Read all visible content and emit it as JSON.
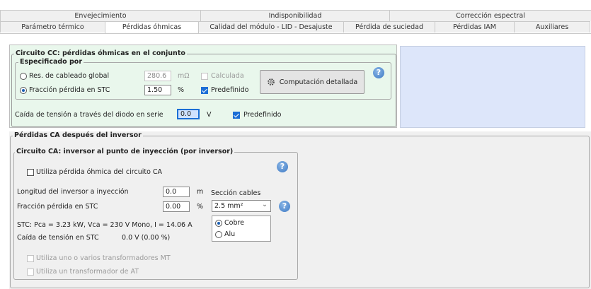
{
  "tabs_top": [
    "Envejecimiento",
    "Indisponibilidad",
    "Corrección espectral"
  ],
  "tabs_bottom": [
    {
      "label": "Parámetro térmico",
      "active": false
    },
    {
      "label": "Pérdidas óhmicas",
      "active": true
    },
    {
      "label": "Calidad del módulo - LID - Desajuste",
      "active": false
    },
    {
      "label": "Pérdida de suciedad",
      "active": false
    },
    {
      "label": "Pérdidas IAM",
      "active": false
    },
    {
      "label": "Auxiliares",
      "active": false
    }
  ],
  "dc": {
    "title": "Circuito CC: pérdidas óhmicas en el conjunto",
    "specified_title": "Especificado por",
    "res_global_label": "Res. de cableado global",
    "res_global_value": "280.6",
    "res_global_unit": "mΩ",
    "calculated_label": "Calculada",
    "fraction_label": "Fracción pérdida en STC",
    "fraction_value": "1.50",
    "fraction_unit": "%",
    "default_label": "Predefinido",
    "detailed_button": "Computación detallada",
    "diode_label": "Caída de tensión a través del diodo en serie",
    "diode_value": "0.0",
    "diode_unit": "V",
    "diode_default_label": "Predefinido",
    "colors": {
      "bg": "#e9f7ec",
      "side_panel": "#dde6fa"
    }
  },
  "ac": {
    "title": "Pérdidas CA después del inversor",
    "circuit_title": "Circuito CA: inversor al punto de inyección  (por inversor)",
    "use_ohmic_label": "Utiliza pérdida óhmica del circuito CA",
    "length_label": "Longitud del inversor a inyección",
    "length_value": "0.0",
    "length_unit": "m",
    "fraction_label": "Fracción pérdida en STC",
    "fraction_value": "0.00",
    "fraction_unit": "%",
    "section_label": "Sección cables",
    "section_value": "2.5 mm²",
    "stc_line": "STC: Pca = 3.23 kW,  Vca = 230 V Mono,  I = 14.06 A",
    "drop_label": "Caída de tensión en STC",
    "drop_value": "0.0 V  (0.00 %)",
    "copper_label": "Cobre",
    "aluminum_label": "Alu",
    "mt_label": "Utiliza uno o varios transformadores MT",
    "at_label": "Utiliza un transformador de AT"
  }
}
